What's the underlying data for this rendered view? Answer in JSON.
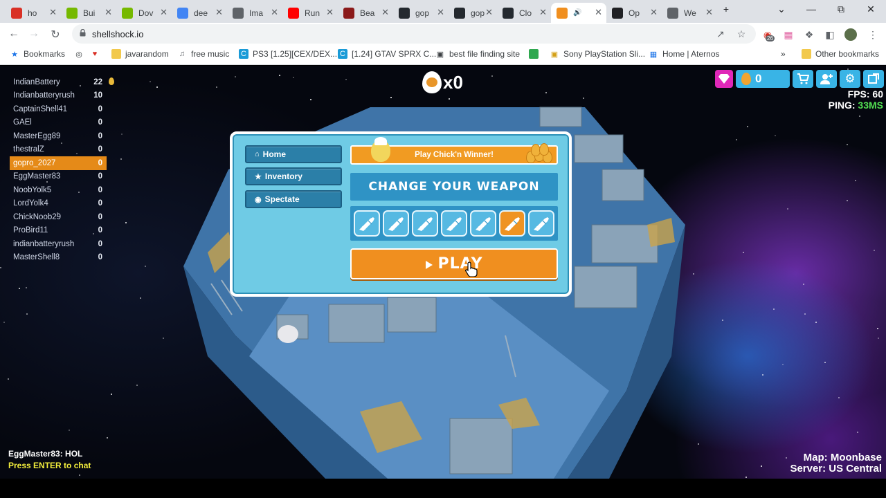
{
  "browser": {
    "tabs": [
      {
        "title": "ho",
        "favicon": "google-red-icon",
        "color": "#d93025"
      },
      {
        "title": "Bui",
        "favicon": "nvidia-icon",
        "color": "#76b900"
      },
      {
        "title": "Dov",
        "favicon": "nvidia-icon",
        "color": "#76b900"
      },
      {
        "title": "dee",
        "favicon": "google-icon",
        "color": "#4285f4"
      },
      {
        "title": "Ima",
        "favicon": "chart-line-icon",
        "color": "#5f6368"
      },
      {
        "title": "Run",
        "favicon": "youtube-icon",
        "color": "#ff0000"
      },
      {
        "title": "Bea",
        "favicon": "m-icon",
        "color": "#8b1a1a"
      },
      {
        "title": "gop",
        "favicon": "github-icon",
        "color": "#24292f"
      },
      {
        "title": "gop",
        "favicon": "github-icon",
        "color": "#24292f"
      },
      {
        "title": "Clo",
        "favicon": "github-icon",
        "color": "#24292f"
      },
      {
        "title": "",
        "favicon": "shellshock-icon",
        "color": "#f08f1f",
        "active": true
      },
      {
        "title": "Op",
        "favicon": "openai-icon",
        "color": "#202124"
      },
      {
        "title": "We",
        "favicon": "globe-icon",
        "color": "#5f6368"
      }
    ],
    "url": "shellshock.io",
    "extension_badge": "26",
    "bookmarks": [
      {
        "label": "Bookmarks",
        "icon": "star-icon"
      },
      {
        "label": "",
        "icon": "globe-icon"
      },
      {
        "label": "",
        "icon": "heart-icon"
      },
      {
        "label": "javarandom",
        "icon": "folder-icon"
      },
      {
        "label": "free music",
        "icon": "music-icon"
      },
      {
        "label": "PS3 [1.25][CEX/DEX...",
        "icon": "c-icon"
      },
      {
        "label": "[1.24] GTAV SPRX C...",
        "icon": "c-icon"
      },
      {
        "label": "best file finding site",
        "icon": "bag-icon"
      },
      {
        "label": "",
        "icon": "green-square-icon"
      },
      {
        "label": "Sony PlayStation Sli...",
        "icon": "yellow-bag-icon"
      },
      {
        "label": "Home | Aternos",
        "icon": "aternos-icon"
      }
    ],
    "other_bookmarks": "Other bookmarks"
  },
  "leaderboard": [
    {
      "name": "IndianBattery",
      "score": "22"
    },
    {
      "name": "Indianbatteryrush",
      "score": "10"
    },
    {
      "name": "CaptainShell41",
      "score": "0"
    },
    {
      "name": "GAEl",
      "score": "0"
    },
    {
      "name": "MasterEgg89",
      "score": "0"
    },
    {
      "name": "thestralZ",
      "score": "0"
    },
    {
      "name": "gopro_2027",
      "score": "0",
      "me": true
    },
    {
      "name": "EggMaster83",
      "score": "0"
    },
    {
      "name": "NoobYolk5",
      "score": "0"
    },
    {
      "name": "LordYolk4",
      "score": "0"
    },
    {
      "name": "ChickNoob29",
      "score": "0"
    },
    {
      "name": "ProBird11",
      "score": "0"
    },
    {
      "name": "indianbatteryrush",
      "score": "0"
    },
    {
      "name": "MasterShell8",
      "score": "0"
    }
  ],
  "kills": "x0",
  "eggs": "0",
  "stats": {
    "fps_label": "FPS:",
    "fps": "60",
    "ping_label": "PING:",
    "ping": "33MS"
  },
  "menu": {
    "home": "Home",
    "inventory": "Inventory",
    "spectate": "Spectate",
    "chick_banner": "Play Chick'n Winner!",
    "weapon_title": "CHANGE YOUR WEAPON",
    "play": "PLAY",
    "weapons": [
      "assault-rifle-icon",
      "shotgun-icon",
      "sniper-rifle-icon",
      "rpg-icon",
      "smg-icon",
      "crackshot-icon",
      "trihard-icon"
    ],
    "selected_weapon_index": 5
  },
  "chat": {
    "message": "EggMaster83: HOL",
    "hint": "Press ENTER to chat"
  },
  "map_info": {
    "map": "Map: Moonbase",
    "server": "Server: US Central"
  },
  "colors": {
    "accent_orange": "#f08f1f",
    "panel_blue": "#6fcbe5",
    "ping_green": "#52e052",
    "gem_pink": "#e028b8"
  }
}
